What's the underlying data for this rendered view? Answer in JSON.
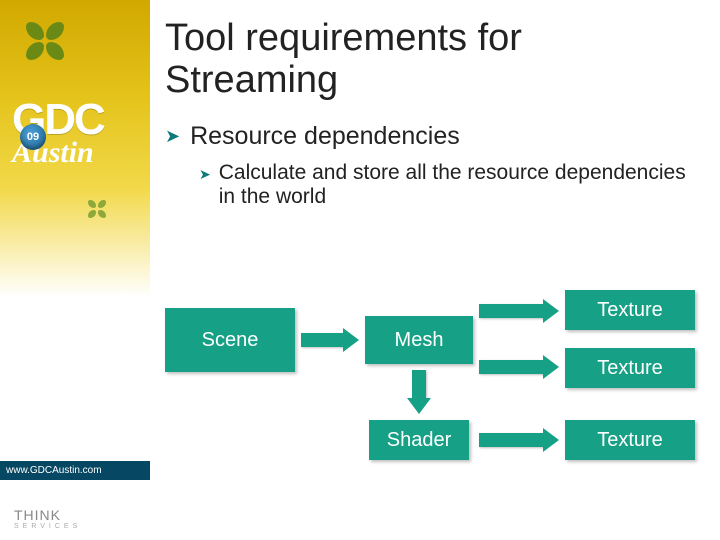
{
  "sidebar": {
    "gdc": "GDC",
    "badge_year": "09",
    "austin": "Austin",
    "url": "www.GDCAustin.com",
    "brand": "THINK",
    "brand_tag": "SERVICES"
  },
  "slide": {
    "title": "Tool requirements for Streaming",
    "bullet1": "Resource dependencies",
    "bullet2": "Calculate and store all the resource dependencies in the world"
  },
  "diagram": {
    "scene": "Scene",
    "mesh": "Mesh",
    "shader": "Shader",
    "tex1": "Texture",
    "tex2": "Texture",
    "tex3": "Texture"
  }
}
